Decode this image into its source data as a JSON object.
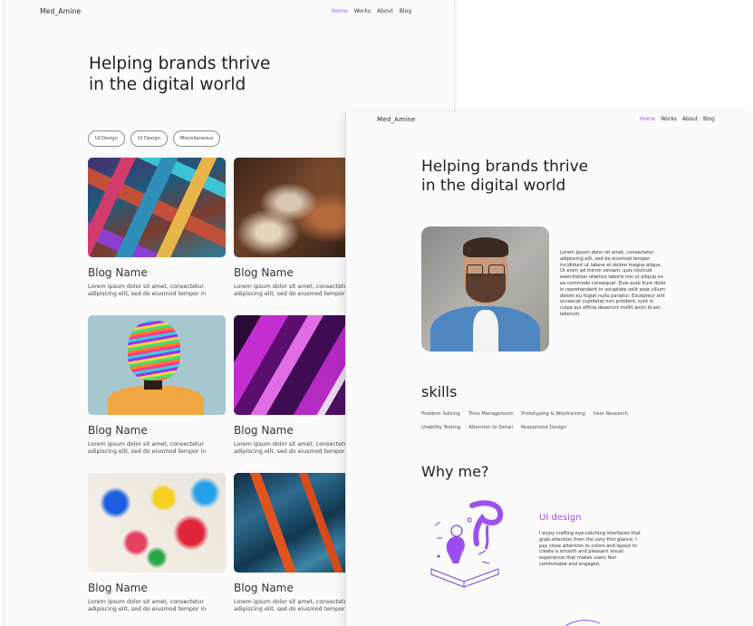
{
  "back": {
    "logo": "Med_Amine",
    "nav": [
      "Home",
      "Works",
      "About",
      "Blog"
    ],
    "hero_line1": "Helping brands thrive",
    "hero_line2": "in the digital world",
    "filters": [
      "UI Design",
      "UI Design",
      "Miscellaneous"
    ],
    "cards": [
      {
        "title": "Blog Name",
        "text": "Lorem ipsum dolor sit amet, consectetur adipiscing elit, sed do eiusmod tempor in"
      },
      {
        "title": "Blog Name",
        "text": "Lorem ipsum dolor sit amet, consectetur adipiscing elit, sed do eiusmod tempor in"
      },
      {
        "title": "Blog Name",
        "text": "Lorem ipsum dolor sit amet, consectetur adipiscing elit, sed do eiusmod tempor in"
      },
      {
        "title": "Blog Name",
        "text": "Lorem ipsum dolor sit amet, consectetur adipiscing elit, sed do eiusmod tempor in"
      },
      {
        "title": "Blog Name",
        "text": "Lorem ipsum dolor sit amet, consectetur adipiscing elit, sed do eiusmod tempor in"
      },
      {
        "title": "Blog Name",
        "text": "Lorem ipsum dolor sit amet, consectetur adipiscing elit, sed do eiusmod tempor in"
      }
    ]
  },
  "front": {
    "logo": "Med_Amine",
    "nav": [
      "Home",
      "Works",
      "About",
      "Blog"
    ],
    "hero_line1": "Helping brands thrive",
    "hero_line2": "in the digital world",
    "about_text": "Lorem ipsum dolor sit amet, consectetur adipiscing elit, sed do eiusmod tempor incididunt ut labore et dolore magna aliqua. Ut enim ad minim veniam, quis nostrud exercitation ullamco laboris nisi ut aliquip ex ea commodo consequat. Duis aute irure dolor in reprehenderit in voluptate velit esse cillum dolore eu fugiat nulla pariatur. Excepteur sint occaecat cupidatat non proident, sunt in culpa qui officia deserunt mollit anim id est laborum.",
    "skills_title": "skills",
    "skills": [
      "Problem Solving",
      "Time Management",
      "Prototyping & Wireframing",
      "User Research",
      "Usability Testing",
      "Attention to Detail",
      "Responsive Design"
    ],
    "why_title": "Why me?",
    "ui_title": "UI design",
    "ui_text": "I enjoy crafting eye-catching interfaces that grab attention from the very first glance. I pay close attention to colors and layout to create a smooth and pleasant visual experience that makes users feel comfortable and engaged."
  },
  "colors": {
    "accent": "#9b59f0",
    "background": "#fbfbfb",
    "text": "#222222"
  }
}
